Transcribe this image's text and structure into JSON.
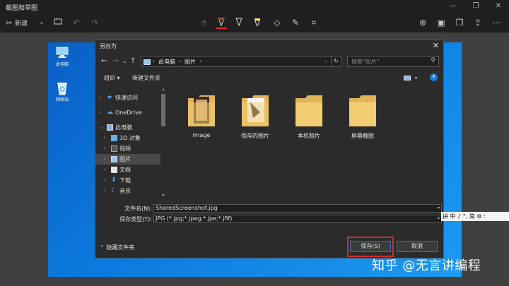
{
  "app": {
    "title": "截图和草图"
  },
  "toolbar": {
    "new_label": "新建"
  },
  "desktop": {
    "icons": [
      {
        "label": "此电脑"
      },
      {
        "label": "回收站"
      }
    ]
  },
  "dialog": {
    "title": "另存为",
    "breadcrumb": [
      "此电脑",
      "图片"
    ],
    "search_placeholder": "搜索\"图片\"",
    "organize_label": "组织 ▾",
    "new_folder_label": "新建文件夹",
    "nav": [
      {
        "label": "快速访问",
        "icon": "star-icon"
      },
      {
        "label": "OneDrive",
        "icon": "cloud-icon"
      },
      {
        "label": "此电脑",
        "icon": "computer-icon"
      },
      {
        "label": "3D 对象",
        "icon": "cube-icon"
      },
      {
        "label": "视频",
        "icon": "video-icon"
      },
      {
        "label": "图片",
        "icon": "picture-icon",
        "selected": true
      },
      {
        "label": "文档",
        "icon": "document-icon"
      },
      {
        "label": "下载",
        "icon": "download-icon"
      },
      {
        "label": "音乐",
        "icon": "music-icon"
      }
    ],
    "folders": [
      {
        "label": "image"
      },
      {
        "label": "保存的图片"
      },
      {
        "label": "本机照片"
      },
      {
        "label": "屏幕截图"
      }
    ],
    "filename_label": "文件名(N):",
    "filename_value": "SharedScreenshot.jpg",
    "filetype_label": "保存类型(T):",
    "filetype_value": "JPG (*.jpg;*.jpeg;*.jpe;*.jfif)",
    "hide_folders_label": "隐藏文件夹",
    "save_label": "保存(S)",
    "cancel_label": "取消"
  },
  "ime": {
    "text": "拼 中 ♪ °, 简 ⚙ :"
  },
  "watermark": "知乎 @无言讲编程",
  "colors": {
    "accent": "#1e7ad6",
    "highlight": "#d42a2a",
    "desktop": "#0b7bdf"
  }
}
